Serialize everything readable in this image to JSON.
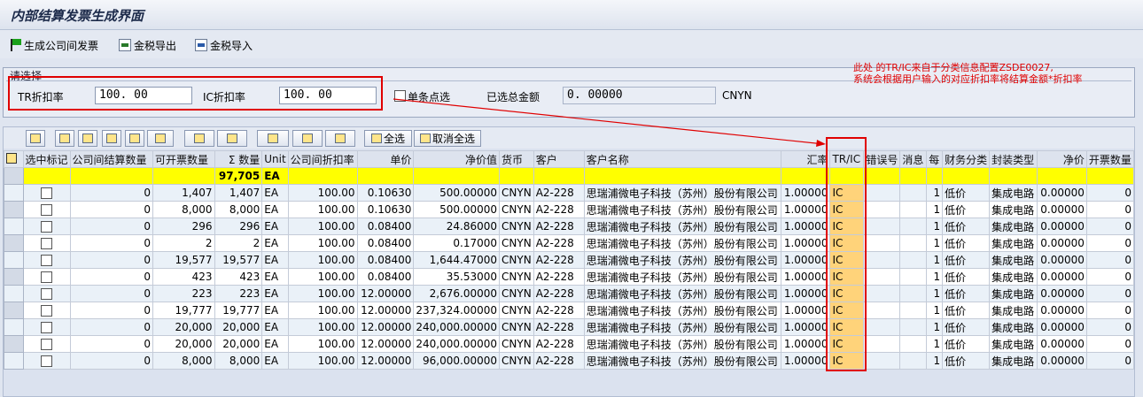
{
  "title": "内部结算发票生成界面",
  "toolbar": [
    {
      "label": "生成公司间发票",
      "icon": "flag-icon"
    },
    {
      "label": "金税导出",
      "icon": "export-icon"
    },
    {
      "label": "金税导入",
      "icon": "import-icon"
    }
  ],
  "selection": {
    "title": "请选择",
    "tr_label": "TR折扣率",
    "tr_value": "100. 00",
    "ic_label": "IC折扣率",
    "ic_value": "100. 00",
    "single_select_label": "单条点选",
    "total_label": "已选总金额",
    "total_value": "0. 00000",
    "currency": "CNYN"
  },
  "annotation": "此处 的TR/IC来自于分类信息配置ZSDE0027,\n系统会根据用户输入的对应折扣率将结算金额*折扣率",
  "grid_buttons": {
    "select_all": "全选",
    "deselect_all": "取消全选"
  },
  "columns": [
    "选中标记",
    "公司间结算数量",
    "可开票数量",
    "Σ   数量",
    "Unit",
    "公司间折扣率",
    "单价",
    "净价值",
    "货币",
    "客户",
    "客户名称",
    "汇率",
    "TR/IC",
    "错误号",
    "消息",
    "每",
    "财务分类",
    "封装类型",
    "净价",
    "开票数量"
  ],
  "summary": {
    "qty": "97,705",
    "unit": "EA"
  },
  "rows": [
    {
      "c1": "0",
      "c2": "1,407",
      "c3": "1,407",
      "u": "EA",
      "d": "100.00",
      "p": "0.10630",
      "v": "500.00000",
      "cur": "CNYN",
      "cust": "A2-228",
      "name": "思瑞浦微电子科技（苏州）股份有限公司",
      "fx": "1.00000",
      "tric": "IC",
      "per": "1",
      "fin": "低价",
      "pkg": "集成电路",
      "np": "0.00000",
      "inv": "0"
    },
    {
      "c1": "0",
      "c2": "8,000",
      "c3": "8,000",
      "u": "EA",
      "d": "100.00",
      "p": "0.10630",
      "v": "500.00000",
      "cur": "CNYN",
      "cust": "A2-228",
      "name": "思瑞浦微电子科技（苏州）股份有限公司",
      "fx": "1.00000",
      "tric": "IC",
      "per": "1",
      "fin": "低价",
      "pkg": "集成电路",
      "np": "0.00000",
      "inv": "0"
    },
    {
      "c1": "0",
      "c2": "296",
      "c3": "296",
      "u": "EA",
      "d": "100.00",
      "p": "0.08400",
      "v": "24.86000",
      "cur": "CNYN",
      "cust": "A2-228",
      "name": "思瑞浦微电子科技（苏州）股份有限公司",
      "fx": "1.00000",
      "tric": "IC",
      "per": "1",
      "fin": "低价",
      "pkg": "集成电路",
      "np": "0.00000",
      "inv": "0"
    },
    {
      "c1": "0",
      "c2": "2",
      "c3": "2",
      "u": "EA",
      "d": "100.00",
      "p": "0.08400",
      "v": "0.17000",
      "cur": "CNYN",
      "cust": "A2-228",
      "name": "思瑞浦微电子科技（苏州）股份有限公司",
      "fx": "1.00000",
      "tric": "IC",
      "per": "1",
      "fin": "低价",
      "pkg": "集成电路",
      "np": "0.00000",
      "inv": "0"
    },
    {
      "c1": "0",
      "c2": "19,577",
      "c3": "19,577",
      "u": "EA",
      "d": "100.00",
      "p": "0.08400",
      "v": "1,644.47000",
      "cur": "CNYN",
      "cust": "A2-228",
      "name": "思瑞浦微电子科技（苏州）股份有限公司",
      "fx": "1.00000",
      "tric": "IC",
      "per": "1",
      "fin": "低价",
      "pkg": "集成电路",
      "np": "0.00000",
      "inv": "0"
    },
    {
      "c1": "0",
      "c2": "423",
      "c3": "423",
      "u": "EA",
      "d": "100.00",
      "p": "0.08400",
      "v": "35.53000",
      "cur": "CNYN",
      "cust": "A2-228",
      "name": "思瑞浦微电子科技（苏州）股份有限公司",
      "fx": "1.00000",
      "tric": "IC",
      "per": "1",
      "fin": "低价",
      "pkg": "集成电路",
      "np": "0.00000",
      "inv": "0"
    },
    {
      "c1": "0",
      "c2": "223",
      "c3": "223",
      "u": "EA",
      "d": "100.00",
      "p": "12.00000",
      "v": "2,676.00000",
      "cur": "CNYN",
      "cust": "A2-228",
      "name": "思瑞浦微电子科技（苏州）股份有限公司",
      "fx": "1.00000",
      "tric": "IC",
      "per": "1",
      "fin": "低价",
      "pkg": "集成电路",
      "np": "0.00000",
      "inv": "0"
    },
    {
      "c1": "0",
      "c2": "19,777",
      "c3": "19,777",
      "u": "EA",
      "d": "100.00",
      "p": "12.00000",
      "v": "237,324.00000",
      "cur": "CNYN",
      "cust": "A2-228",
      "name": "思瑞浦微电子科技（苏州）股份有限公司",
      "fx": "1.00000",
      "tric": "IC",
      "per": "1",
      "fin": "低价",
      "pkg": "集成电路",
      "np": "0.00000",
      "inv": "0"
    },
    {
      "c1": "0",
      "c2": "20,000",
      "c3": "20,000",
      "u": "EA",
      "d": "100.00",
      "p": "12.00000",
      "v": "240,000.00000",
      "cur": "CNYN",
      "cust": "A2-228",
      "name": "思瑞浦微电子科技（苏州）股份有限公司",
      "fx": "1.00000",
      "tric": "IC",
      "per": "1",
      "fin": "低价",
      "pkg": "集成电路",
      "np": "0.00000",
      "inv": "0"
    },
    {
      "c1": "0",
      "c2": "20,000",
      "c3": "20,000",
      "u": "EA",
      "d": "100.00",
      "p": "12.00000",
      "v": "240,000.00000",
      "cur": "CNYN",
      "cust": "A2-228",
      "name": "思瑞浦微电子科技（苏州）股份有限公司",
      "fx": "1.00000",
      "tric": "IC",
      "per": "1",
      "fin": "低价",
      "pkg": "集成电路",
      "np": "0.00000",
      "inv": "0"
    },
    {
      "c1": "0",
      "c2": "8,000",
      "c3": "8,000",
      "u": "EA",
      "d": "100.00",
      "p": "12.00000",
      "v": "96,000.00000",
      "cur": "CNYN",
      "cust": "A2-228",
      "name": "思瑞浦微电子科技（苏州）股份有限公司",
      "fx": "1.00000",
      "tric": "IC",
      "per": "1",
      "fin": "低价",
      "pkg": "集成电路",
      "np": "0.00000",
      "inv": "0"
    }
  ]
}
